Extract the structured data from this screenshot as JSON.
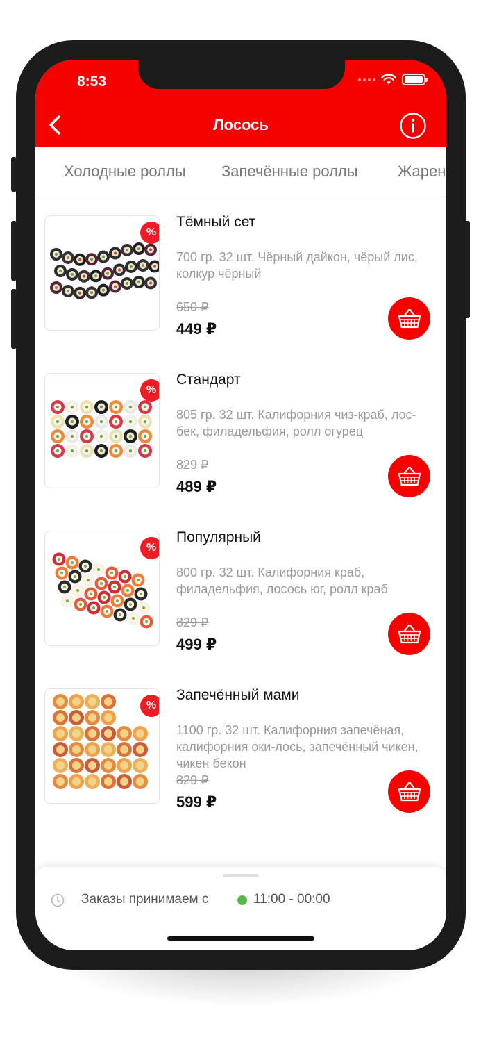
{
  "status_bar": {
    "time": "8:53"
  },
  "header": {
    "title": "Лосось"
  },
  "tabs": [
    "Холодные роллы",
    "Запечённые роллы",
    "Жарен"
  ],
  "products": [
    {
      "name": "Тёмный сет",
      "description": "700 гр. 32 шт. Чёрный дайкон, чёрый лис, колкур чёрный",
      "old_price": "650 ₽",
      "price": "449 ₽",
      "badge": "%"
    },
    {
      "name": "Стандарт",
      "description": "805 гр. 32 шт. Калифорния чиз-краб, лос-бек, филадельфия, ролл огурец",
      "old_price": "829 ₽",
      "price": "489 ₽",
      "badge": "%"
    },
    {
      "name": "Популярный",
      "description": "800 гр. 32 шт. Калифорния краб, филадельфия, лосось юг, ролл краб",
      "old_price": "829 ₽",
      "price": "499 ₽",
      "badge": "%"
    },
    {
      "name": "Запечённый мами",
      "description": "1100 гр. 32 шт. Калифорния запечёная, калифорния оки-лось, запечённый чикен, чикен бекон",
      "old_price": "829 ₽",
      "price": "599 ₽",
      "badge": "%"
    }
  ],
  "footer": {
    "hours_label": "Заказы принимаем с",
    "hours_time": "11:00 - 00:00"
  },
  "colors": {
    "brand": "#f60000",
    "badge": "#ee1c25",
    "open_status": "#56b947"
  }
}
